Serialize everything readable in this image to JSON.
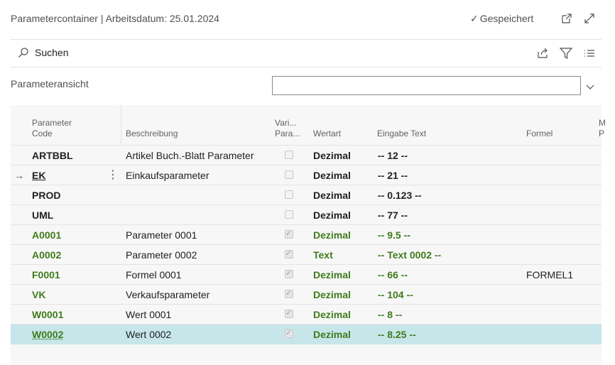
{
  "header": {
    "title": "Parametercontainer | Arbeitsdatum: 25.01.2024",
    "saved_label": "Gespeichert"
  },
  "toolbar": {
    "search_label": "Suchen"
  },
  "filter": {
    "label": "Parameteransicht",
    "value": ""
  },
  "columns": {
    "code_line1": "Parameter",
    "code_line2": "Code",
    "desc": "Beschreibung",
    "var_line1": "Vari...",
    "var_line2": "Para...",
    "wertart": "Wertart",
    "eingabe": "Eingabe Text",
    "formel": "Formel",
    "more_line1": "M",
    "more_line2": "P"
  },
  "rows": [
    {
      "code": "ARTBBL",
      "desc": "Artikel Buch.-Blatt Parameter",
      "var": false,
      "wertart": "Dezimal",
      "eingabe": "-- 12 --",
      "formel": "",
      "green": false
    },
    {
      "code": "EK",
      "desc": "Einkaufsparameter",
      "var": false,
      "wertart": "Dezimal",
      "eingabe": "-- 21 --",
      "formel": "",
      "green": false
    },
    {
      "code": "PROD",
      "desc": "",
      "var": false,
      "wertart": "Dezimal",
      "eingabe": "-- 0.123 --",
      "formel": "",
      "green": false
    },
    {
      "code": "UML",
      "desc": "",
      "var": false,
      "wertart": "Dezimal",
      "eingabe": "-- 77 --",
      "formel": "",
      "green": false
    },
    {
      "code": "A0001",
      "desc": "Parameter 0001",
      "var": true,
      "wertart": "Dezimal",
      "eingabe": "-- 9.5 --",
      "formel": "",
      "green": true
    },
    {
      "code": "A0002",
      "desc": "Parameter 0002",
      "var": true,
      "wertart": "Text",
      "eingabe": "-- Text 0002 --",
      "formel": "",
      "green": true
    },
    {
      "code": "F0001",
      "desc": "Formel 0001",
      "var": true,
      "wertart": "Dezimal",
      "eingabe": "-- 66 --",
      "formel": "FORMEL1",
      "green": true
    },
    {
      "code": "VK",
      "desc": "Verkaufsparameter",
      "var": true,
      "wertart": "Dezimal",
      "eingabe": "-- 104 --",
      "formel": "",
      "green": true
    },
    {
      "code": "W0001",
      "desc": "Wert 0001",
      "var": true,
      "wertart": "Dezimal",
      "eingabe": "-- 8 --",
      "formel": "",
      "green": true
    },
    {
      "code": "W0002",
      "desc": "Wert 0002",
      "var": true,
      "wertart": "Dezimal",
      "eingabe": "-- 8.25 --",
      "formel": "",
      "green": true
    }
  ],
  "icons": {
    "saved": "checkmark-icon",
    "open_new": "open-in-new-window-icon",
    "expand": "expand-icon",
    "search": "search-icon",
    "share": "share-icon",
    "filter": "filter-icon",
    "list": "list-view-icon",
    "dropdown": "chevron-down-icon",
    "current_row": "arrow-right-icon",
    "row_menu": "more-vertical-icon"
  },
  "colors": {
    "green_text": "#3f7b1c",
    "selected_row": "#c6e6ea"
  }
}
